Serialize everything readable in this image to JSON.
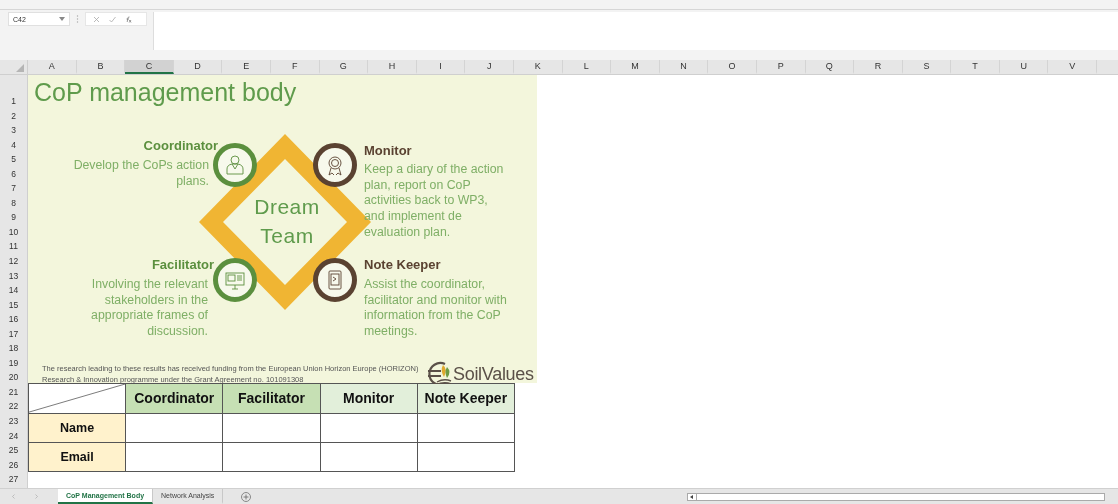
{
  "formula_bar": {
    "name_box": "C42"
  },
  "columns": [
    {
      "label": "A",
      "selected": false
    },
    {
      "label": "B",
      "selected": false
    },
    {
      "label": "C",
      "selected": true
    },
    {
      "label": "D",
      "selected": false
    },
    {
      "label": "E",
      "selected": false
    },
    {
      "label": "F",
      "selected": false
    },
    {
      "label": "G",
      "selected": false
    },
    {
      "label": "H",
      "selected": false
    },
    {
      "label": "I",
      "selected": false
    },
    {
      "label": "J",
      "selected": false
    },
    {
      "label": "K",
      "selected": false
    },
    {
      "label": "L",
      "selected": false
    },
    {
      "label": "M",
      "selected": false
    },
    {
      "label": "N",
      "selected": false
    },
    {
      "label": "O",
      "selected": false
    },
    {
      "label": "P",
      "selected": false
    },
    {
      "label": "Q",
      "selected": false
    },
    {
      "label": "R",
      "selected": false
    },
    {
      "label": "S",
      "selected": false
    },
    {
      "label": "T",
      "selected": false
    },
    {
      "label": "U",
      "selected": false
    },
    {
      "label": "V",
      "selected": false
    }
  ],
  "rows": [
    "1",
    "2",
    "3",
    "4",
    "5",
    "6",
    "7",
    "8",
    "9",
    "10",
    "11",
    "12",
    "13",
    "14",
    "15",
    "16",
    "17",
    "18",
    "19",
    "20",
    "21",
    "22",
    "23",
    "24",
    "25",
    "26",
    "27"
  ],
  "panel": {
    "title": "CoP management body",
    "center_text": [
      "Dream",
      "Team"
    ],
    "roles": [
      {
        "name": "Coordinator",
        "description": "Develop the CoPs action\nplans.",
        "color": "#5b8f3e"
      },
      {
        "name": "Monitor",
        "description": "Keep a diary of the action\nplan, report on CoP\nactivities back to WP3,\nand implement de\nevaluation plan.",
        "color": "#5a4231"
      },
      {
        "name": "Facilitator",
        "description": "Involving the relevant\nstakeholders in the\nappropriate frames of\ndiscussion.",
        "color": "#5b8f3e"
      },
      {
        "name": "Note Keeper",
        "description": "Assist the coordinator,\nfacilitator and monitor with\ninformation from the CoP\nmeetings.",
        "color": "#5a4231"
      }
    ],
    "funding": "The research leading to these results has received funding from the European Union Horizon Europe (HORIZON)\nResearch & Innovation programme under the Grant Agreement no.  101091308",
    "logo": "SoilValues"
  },
  "table": {
    "columns": [
      {
        "label": "Coordinator",
        "color": "#c6e0b4"
      },
      {
        "label": "Facilitator",
        "color": "#c6e0b4"
      },
      {
        "label": "Monitor",
        "color": "#e2efda"
      },
      {
        "label": "Note Keeper",
        "color": "#e2efda"
      }
    ],
    "rows": [
      {
        "label": "Name"
      },
      {
        "label": "Email"
      }
    ]
  },
  "sheet_tabs": [
    {
      "label": "CoP Management Body",
      "selected": true
    },
    {
      "label": "Network Analysis",
      "selected": false
    }
  ]
}
